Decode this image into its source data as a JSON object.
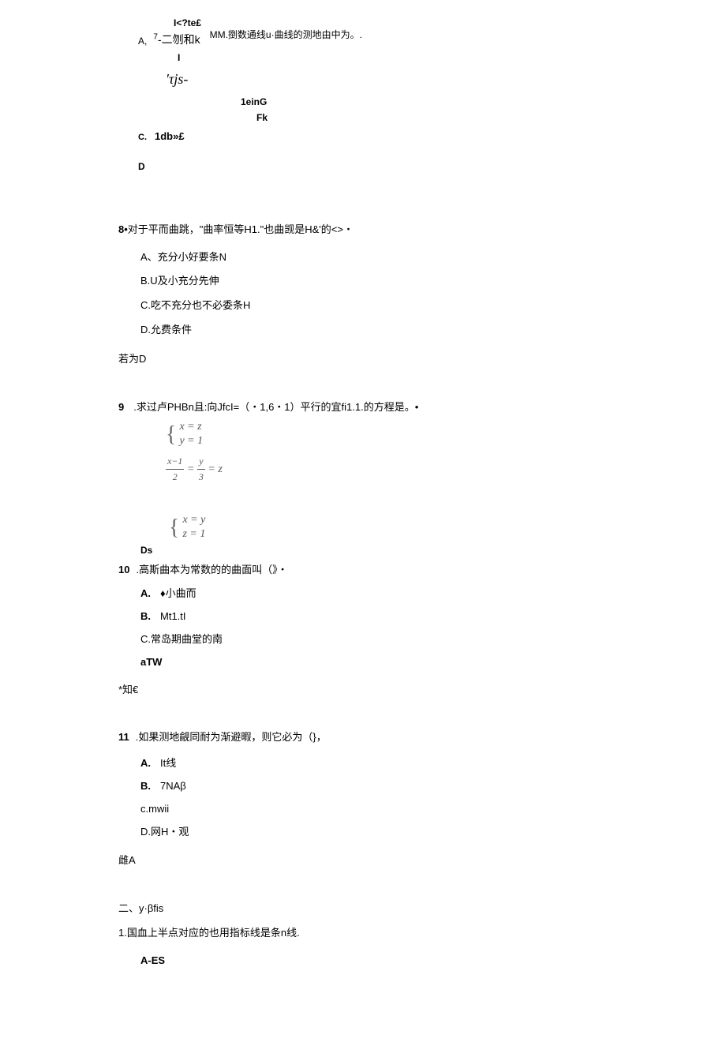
{
  "q7": {
    "top": "I<?te£",
    "a_label": "A,",
    "mid_sup": "7",
    "mid_text": "-二刎和k",
    "mm": "MM.捯数通线u·曲线的测地由中为。.",
    "i": "I",
    "tjs": "′τjs-",
    "ein": "1einG",
    "fk": "Fk",
    "c_label": "C.",
    "onedb": "1db»£",
    "d": "D"
  },
  "q8": {
    "stem_prefix": "8•",
    "stem_text": "对于平而曲跳，\"曲率恒等H1.\"也曲觊是H&'的<>・",
    "opts": {
      "a": "A、充分小好要条N",
      "b": "B.U及小充分先伸",
      "c": "C.吃不充分也不必委条H",
      "d": "D.允费条件"
    },
    "answer": "若为D"
  },
  "q9": {
    "num": "9",
    "stem": ".求过卢PHBn且:向JfcI=（・1,6・1）平行的宜fi1.1.的方程是。•",
    "m1_l1": "x = z",
    "m1_l2": "y = 1",
    "frac1_num": "x−1",
    "frac1_den": "2",
    "frac2_num": "y",
    "frac2_den": "3",
    "frac_eq": " = ",
    "frac_tail": " = z",
    "m2_l1": "x = y",
    "m2_l2": "z = 1",
    "ds": "Ds"
  },
  "q10": {
    "num": "10",
    "stem": ".高斯曲本为常数的的曲面叫（》・",
    "a_lbl": "A.",
    "a_txt": "♦小曲而",
    "b_lbl": "B.",
    "b_txt": "Mt1.tI",
    "c": "C.常岛期曲堂的南",
    "d": "aTW",
    "answer": "*知€"
  },
  "q11": {
    "num": "11",
    "stem": ".如果测地觎同耐为渐避暇，则它必为（}，",
    "a_lbl": "A.",
    "a_txt": "It线",
    "b_lbl": "B.",
    "b_txt": "7NAβ",
    "c": "c.mwii",
    "d": "D.网H・观",
    "answer": "雌A"
  },
  "section2": {
    "heading": "二、y·βfis",
    "item1": "1.国血上半点对应的也用指标线是条n线.",
    "sub": "A-ES"
  }
}
